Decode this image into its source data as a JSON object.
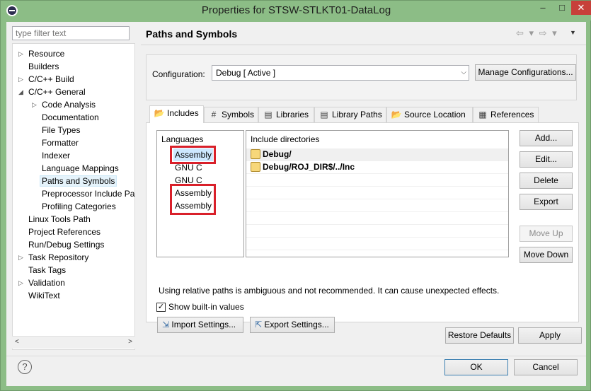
{
  "window": {
    "title": "Properties for STSW-STLKT01-DataLog",
    "min_glyph": "–",
    "max_glyph": "□",
    "close_glyph": "✕"
  },
  "filter": {
    "placeholder": "type filter text"
  },
  "tree": [
    {
      "label": "Resource",
      "expandable": true
    },
    {
      "label": "Builders"
    },
    {
      "label": "C/C++ Build",
      "expandable": true
    },
    {
      "label": "C/C++ General",
      "expanded": true
    },
    {
      "label": "Code Analysis",
      "expandable": true
    },
    {
      "label": "Documentation"
    },
    {
      "label": "File Types"
    },
    {
      "label": "Formatter"
    },
    {
      "label": "Indexer"
    },
    {
      "label": "Language Mappings"
    },
    {
      "label": "Paths and Symbols",
      "selected": true
    },
    {
      "label": "Preprocessor Include Pa"
    },
    {
      "label": "Profiling Categories"
    },
    {
      "label": "Linux Tools Path"
    },
    {
      "label": "Project References"
    },
    {
      "label": "Run/Debug Settings"
    },
    {
      "label": "Task Repository",
      "expandable": true
    },
    {
      "label": "Task Tags"
    },
    {
      "label": "Validation",
      "expandable": true
    },
    {
      "label": "WikiText"
    }
  ],
  "page": {
    "title": "Paths and Symbols",
    "nav_arrows": "⇦ ▾ ⇨ ▾",
    "menu_glyph": "▼"
  },
  "config": {
    "label": "Configuration:",
    "value": "Debug  [ Active ]",
    "manage_button": "Manage Configurations..."
  },
  "tabs": [
    {
      "label": "Includes",
      "icon": "📂",
      "active": true
    },
    {
      "label": "Symbols",
      "icon": "#"
    },
    {
      "label": "Libraries",
      "icon": "▤"
    },
    {
      "label": "Library Paths",
      "icon": "▤"
    },
    {
      "label": "Source Location",
      "icon": "📂"
    },
    {
      "label": "References",
      "icon": "▦"
    }
  ],
  "languages": {
    "header": "Languages",
    "items": [
      "Assembly",
      "GNU C",
      "GNU C",
      "Assembly",
      "Assembly"
    ]
  },
  "includes": {
    "header": "Include directories",
    "items": [
      "Debug/",
      "Debug/ROJ_DIR$/../Inc"
    ]
  },
  "side_buttons": {
    "add": "Add...",
    "edit": "Edit...",
    "delete": "Delete",
    "export": "Export",
    "move_up": "Move Up",
    "move_down": "Move Down"
  },
  "warning_text": "Using relative paths is ambiguous and not recommended. It can cause unexpected effects.",
  "show_builtin": {
    "label": "Show built-in values",
    "checked": true,
    "glyph": "✓"
  },
  "import_settings": "Import Settings...",
  "export_settings": "Export Settings...",
  "restore_defaults": "Restore Defaults",
  "apply": "Apply",
  "ok": "OK",
  "cancel": "Cancel",
  "help_glyph": "?"
}
